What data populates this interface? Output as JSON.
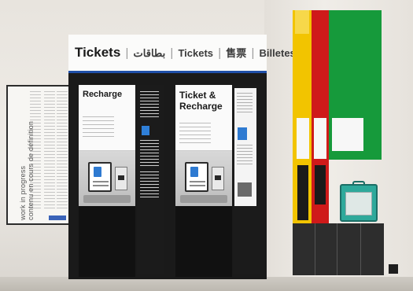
{
  "scene": {
    "description_tag": "ticket machine wall photo"
  },
  "banner": {
    "main": "Tickets",
    "arabic": "بطاقات",
    "french": "Tickets",
    "chinese": "售票",
    "spanish": "Billetes"
  },
  "machines": [
    {
      "title": "Recharge"
    },
    {
      "title_line1": "Ticket &",
      "title_line2": "Recharge"
    }
  ],
  "notice": {
    "vertical_line1": "work in progress",
    "vertical_line2": "contenu en cours de définition"
  },
  "colors": {
    "banner_rule": "#1f4fa8",
    "yellow": "#f2c400",
    "red": "#cf1a1a",
    "green": "#169a3b",
    "aed": "#2ea99b"
  }
}
